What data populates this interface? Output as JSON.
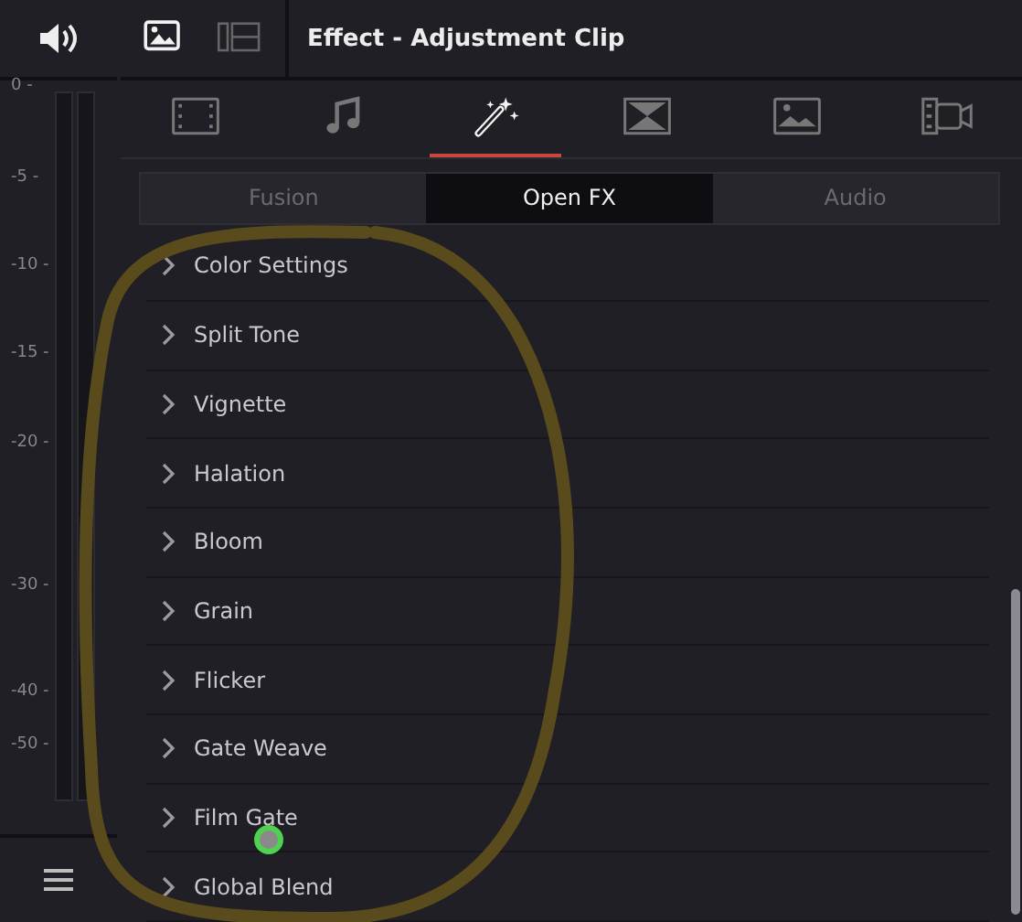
{
  "meter": {
    "scale": [
      "0 -",
      "-5 -",
      "-10 -",
      "-15 -",
      "-20 -",
      "-30 -",
      "-40 -",
      "-50 -"
    ]
  },
  "header": {
    "title": "Effect - Adjustment Clip",
    "views": [
      {
        "kind": "image",
        "selected": true
      },
      {
        "kind": "split",
        "selected": false
      }
    ]
  },
  "tabs": [
    {
      "kind": "video",
      "selected": false
    },
    {
      "kind": "audio",
      "selected": false
    },
    {
      "kind": "effects",
      "selected": true
    },
    {
      "kind": "transition",
      "selected": false
    },
    {
      "kind": "image",
      "selected": false
    },
    {
      "kind": "camera",
      "selected": false
    }
  ],
  "subtabs": [
    {
      "label": "Fusion",
      "selected": false
    },
    {
      "label": "Open FX",
      "selected": true
    },
    {
      "label": "Audio",
      "selected": false
    }
  ],
  "effects": [
    {
      "label": "Color Settings",
      "expanded": false
    },
    {
      "label": "Split Tone",
      "expanded": false
    },
    {
      "label": "Vignette",
      "expanded": false
    },
    {
      "label": "Halation",
      "expanded": false
    },
    {
      "label": "Bloom",
      "expanded": false
    },
    {
      "label": "Grain",
      "expanded": false
    },
    {
      "label": "Flicker",
      "expanded": false
    },
    {
      "label": "Gate Weave",
      "expanded": false
    },
    {
      "label": "Film Gate",
      "expanded": false
    },
    {
      "label": "Global Blend",
      "expanded": false
    }
  ]
}
